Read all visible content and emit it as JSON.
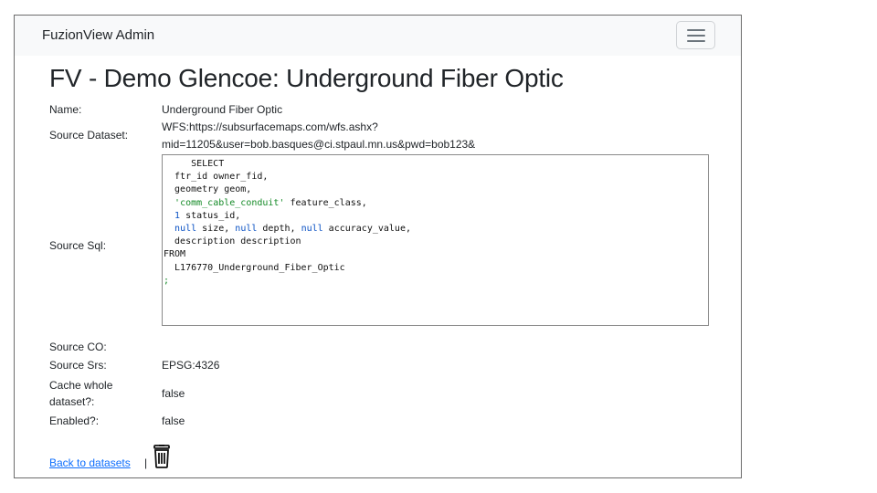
{
  "navbar": {
    "brand": "FuzionView Admin",
    "toggle_icon": "hamburger-menu-icon"
  },
  "page": {
    "title": "FV - Demo Glencoe: Underground Fiber Optic"
  },
  "fields": {
    "name": {
      "label": "Name:",
      "value": "Underground Fiber Optic"
    },
    "source_dataset": {
      "label": "Source Dataset:",
      "value_line1": "WFS:https://subsurfacemaps.com/wfs.ashx?",
      "value_line2": "mid=11205&user=bob.basques@ci.stpaul.mn.us&pwd=bob123&"
    },
    "source_sql": {
      "label": "Source Sql:",
      "lines": [
        "     SELECT",
        "  ftr_id owner_fid,",
        "  geometry geom,",
        "  'comm_cable_conduit' feature_class,",
        "  1 status_id,",
        "  null size, null depth, null accuracy_value,",
        "  description description",
        "FROM",
        "  L176770_Underground_Fiber_Optic",
        ";"
      ]
    },
    "source_co": {
      "label": "Source CO:",
      "value": ""
    },
    "source_srs": {
      "label": "Source Srs:",
      "value": "EPSG:4326"
    },
    "cache_whole": {
      "label_line1": "Cache whole",
      "label_line2": "dataset?:",
      "value": "false"
    },
    "enabled": {
      "label": "Enabled?:",
      "value": "false"
    }
  },
  "footer": {
    "back_link": "Back to datasets",
    "separator": "|",
    "delete_icon": "trash-icon"
  }
}
